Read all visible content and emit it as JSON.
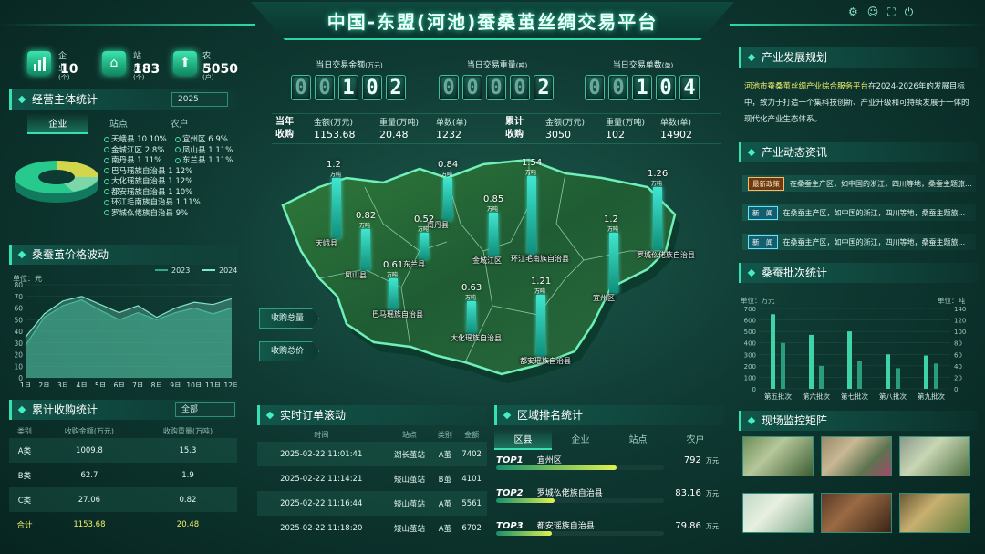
{
  "header": {
    "title": "中国-东盟(河池)蚕桑茧丝绸交易平台"
  },
  "top_stats": [
    {
      "label": "企业",
      "unit": "(个)",
      "value": "10",
      "icon": "factory-icon"
    },
    {
      "label": "站点",
      "unit": "(个)",
      "value": "183",
      "icon": "building-icon"
    },
    {
      "label": "农户",
      "unit": "(户)",
      "value": "5050",
      "icon": "house-icon"
    }
  ],
  "operators": {
    "title": "经营主体统计",
    "year": "2025",
    "tabs": [
      "企业",
      "站点",
      "农户"
    ],
    "legend_left": [
      {
        "name": "天峨县",
        "count": "10",
        "pct": "10%"
      },
      {
        "name": "金城江区",
        "count": "2",
        "pct": "8%"
      },
      {
        "name": "南丹县",
        "count": "1",
        "pct": "11%"
      },
      {
        "name": "巴马瑶族自治县",
        "count": "1",
        "pct": "12%"
      },
      {
        "name": "大化瑶族自治县",
        "count": "1",
        "pct": "12%"
      },
      {
        "name": "都安瑶族自治县",
        "count": "1",
        "pct": "10%"
      },
      {
        "name": "环江毛南族自治县",
        "count": "1",
        "pct": "11%"
      },
      {
        "name": "罗城仫佬族自治县",
        "count": "",
        "pct": "9%"
      }
    ],
    "legend_right": [
      {
        "name": "宜州区",
        "count": "6",
        "pct": "9%"
      },
      {
        "name": "凤山县",
        "count": "1",
        "pct": "11%"
      },
      {
        "name": "东兰县",
        "count": "1",
        "pct": "11%"
      }
    ]
  },
  "price_panel": {
    "title": "桑蚕茧价格波动",
    "unit": "单位：元"
  },
  "chart_data": {
    "type": "area",
    "title": "桑蚕茧价格波动",
    "xlabel": "",
    "ylabel": "单位：元",
    "categories": [
      "1月",
      "2月",
      "3月",
      "4月",
      "5月",
      "6月",
      "7月",
      "8月",
      "9月",
      "10月",
      "11月",
      "12月"
    ],
    "ylim": [
      0,
      80
    ],
    "yticks": [
      0,
      10,
      20,
      30,
      40,
      50,
      60,
      70,
      80
    ],
    "legend_position": "top-right",
    "series": [
      {
        "name": "2023",
        "color": "#2fa88a",
        "values": [
          28,
          52,
          62,
          67,
          58,
          50,
          56,
          50,
          56,
          60,
          55,
          60
        ]
      },
      {
        "name": "2024",
        "color": "#7fe6c8",
        "values": [
          35,
          55,
          66,
          70,
          63,
          56,
          62,
          52,
          60,
          65,
          63,
          68
        ]
      }
    ]
  },
  "purchase": {
    "title": "累计收购统计",
    "filter": "全部",
    "headers": [
      "类别",
      "收购金额(万元)",
      "收购重量(万吨)"
    ],
    "rows": [
      [
        "A类",
        "1009.8",
        "15.3"
      ],
      [
        "B类",
        "62.7",
        "1.9"
      ],
      [
        "C类",
        "27.06",
        "0.82"
      ]
    ],
    "total": [
      "合计",
      "1153.68",
      "20.48"
    ]
  },
  "today": {
    "amount_label": "当日交易金额",
    "amount_unit": "(万元)",
    "amount_digits": [
      "0",
      "0",
      "1",
      "0",
      "2"
    ],
    "weight_label": "当日交易重量",
    "weight_unit": "(吨)",
    "weight_digits": [
      "0",
      "0",
      "0",
      "0",
      "2"
    ],
    "orders_label": "当日交易单数",
    "orders_unit": "(单)",
    "orders_digits": [
      "0",
      "0",
      "1",
      "0",
      "4"
    ]
  },
  "summary": {
    "year_label": "当年",
    "year_sub": "收购",
    "year_amount_lbl": "金额(万元)",
    "year_amount": "1153.68",
    "year_weight_lbl": "重量(万吨)",
    "year_weight": "20.48",
    "year_count_lbl": "单数(单)",
    "year_count": "1232",
    "cum_label": "累计",
    "cum_sub": "收购",
    "cum_amount_lbl": "金额(万元)",
    "cum_amount": "3050",
    "cum_weight_lbl": "重量(万吨)",
    "cum_weight": "102",
    "cum_count_lbl": "单数(单)",
    "cum_count": "14902"
  },
  "map": {
    "unit": "万吨",
    "buttons": [
      "收购总量",
      "收购总价"
    ],
    "regions": [
      {
        "name": "天峨县",
        "value": "1.2",
        "level": 1.2
      },
      {
        "name": "南丹县",
        "value": "0.84",
        "level": 0.84
      },
      {
        "name": "环江毛南族自治县",
        "value": "1.54",
        "level": 1.54
      },
      {
        "name": "罗城仫佬族自治县",
        "value": "1.26",
        "level": 1.26
      },
      {
        "name": "凤山县",
        "value": "0.82",
        "level": 0.82
      },
      {
        "name": "东兰县",
        "value": "0.52",
        "level": 0.52
      },
      {
        "name": "金城江区",
        "value": "0.85",
        "level": 0.85
      },
      {
        "name": "宜州区",
        "value": "1.2",
        "level": 1.2
      },
      {
        "name": "巴马瑶族自治县",
        "value": "0.61",
        "level": 0.61
      },
      {
        "name": "大化瑶族自治县",
        "value": "0.63",
        "level": 0.63
      },
      {
        "name": "都安瑶族自治县",
        "value": "1.21",
        "level": 1.21
      }
    ]
  },
  "orders": {
    "title": "实时订单滚动",
    "headers": [
      "时间",
      "站点",
      "类别",
      "金额"
    ],
    "rows": [
      [
        "2025-02-22 11:01:41",
        "湖长茧站",
        "A茧",
        "7402"
      ],
      [
        "2025-02-22 11:14:21",
        "矮山茧站",
        "B茧",
        "4101"
      ],
      [
        "2025-02-22 11:16:44",
        "矮山茧站",
        "A茧",
        "5561"
      ],
      [
        "2025-02-22 11:18:20",
        "矮山茧站",
        "A茧",
        "6702"
      ]
    ]
  },
  "ranking": {
    "title": "区域排名统计",
    "tabs": [
      "区县",
      "企业",
      "站点",
      "农户"
    ],
    "items": [
      {
        "rank": "TOP1",
        "name": "宜州区",
        "value": "792",
        "unit": "万元",
        "fill": 0.72
      },
      {
        "rank": "TOP2",
        "name": "罗城仫佬族自治县",
        "value": "83.16",
        "unit": "万元",
        "fill": 0.35
      },
      {
        "rank": "TOP3",
        "name": "都安瑶族自治县",
        "value": "79.86",
        "unit": "万元",
        "fill": 0.33
      }
    ]
  },
  "plan": {
    "title": "产业发展规划",
    "highlight": "河池市蚕桑茧丝绸产业综合服务平台",
    "text": "在2024-2026年的发展目标中，致力于打造一个集科技创新、产业升级和可持续发展于一体的现代化产业生态体系。"
  },
  "news": {
    "title": "产业动态资讯",
    "items": [
      {
        "tag": "最新政策",
        "hot": true,
        "text": "在桑蚕主产区，如中国的浙江，四川等地，桑蚕主题旅..."
      },
      {
        "tag": "新　闻",
        "hot": false,
        "text": "在桑蚕主产区，如中国的浙江，四川等地，桑蚕主题旅..."
      },
      {
        "tag": "新　闻",
        "hot": false,
        "text": "在桑蚕主产区，如中国的浙江，四川等地，桑蚕主题旅..."
      }
    ]
  },
  "batch": {
    "title": "桑蚕批次统计",
    "left_unit": "单位：万元",
    "right_unit": "单位：吨",
    "categories": [
      "第五批次",
      "第六批次",
      "第七批次",
      "第八批次",
      "第九批次"
    ],
    "left_ticks": [
      "0",
      "100",
      "200",
      "300",
      "400",
      "500",
      "600",
      "700"
    ],
    "right_ticks": [
      "0",
      "20",
      "40",
      "60",
      "80",
      "100",
      "120",
      "140"
    ],
    "amount": [
      650,
      470,
      500,
      300,
      290
    ],
    "weight": [
      80,
      40,
      48,
      36,
      44
    ]
  },
  "monitor": {
    "title": "现场监控矩阵"
  },
  "colors": {
    "accent": "#36e0b0",
    "panel_bg": "#0f3a33",
    "highlight": "#f2f06a"
  }
}
